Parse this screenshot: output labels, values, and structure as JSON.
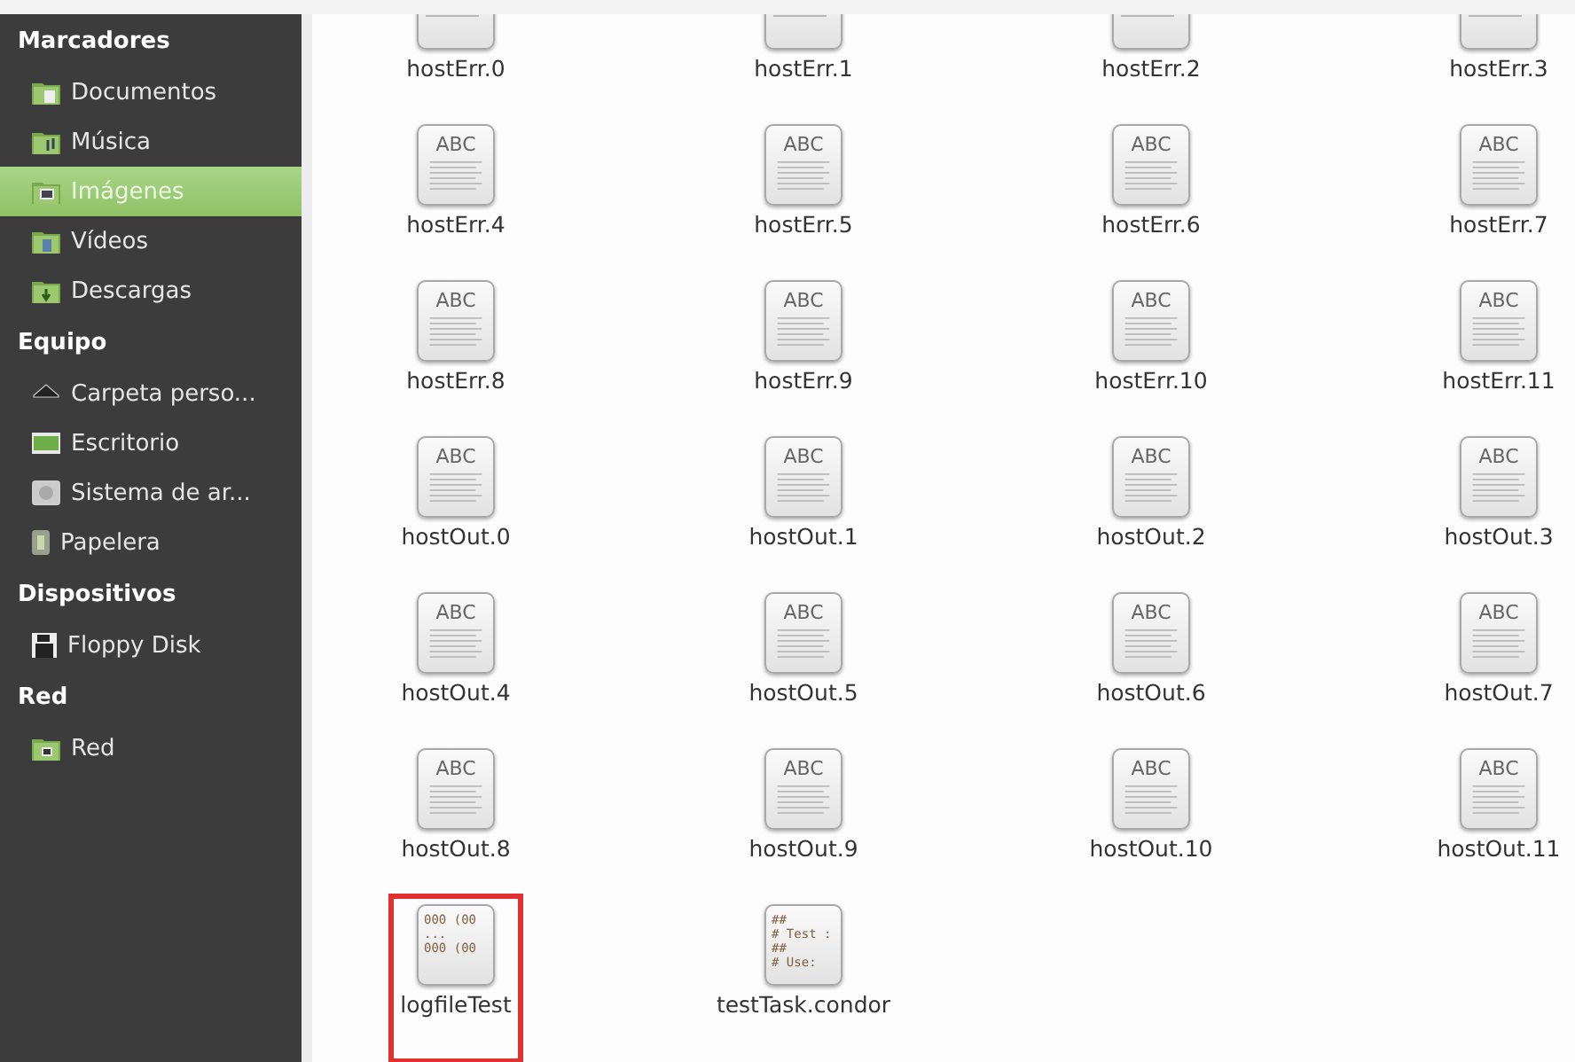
{
  "sidebar": {
    "sections": [
      {
        "title": "Marcadores",
        "items": [
          {
            "label": "Documentos",
            "kind": "folder-doc",
            "selected": false
          },
          {
            "label": "Música",
            "kind": "folder-music",
            "selected": false
          },
          {
            "label": "Imágenes",
            "kind": "folder-picture",
            "selected": true
          },
          {
            "label": "Vídeos",
            "kind": "folder-video",
            "selected": false
          },
          {
            "label": "Descargas",
            "kind": "folder-download",
            "selected": false
          }
        ]
      },
      {
        "title": "Equipo",
        "items": [
          {
            "label": "Carpeta perso...",
            "kind": "home",
            "selected": false
          },
          {
            "label": "Escritorio",
            "kind": "desktop",
            "selected": false
          },
          {
            "label": "Sistema de ar...",
            "kind": "drive",
            "selected": false
          },
          {
            "label": "Papelera",
            "kind": "trash",
            "selected": false
          }
        ]
      },
      {
        "title": "Dispositivos",
        "items": [
          {
            "label": "Floppy Disk",
            "kind": "floppy",
            "selected": false
          }
        ]
      },
      {
        "title": "Red",
        "items": [
          {
            "label": "Red",
            "kind": "folder-network",
            "selected": false
          }
        ]
      }
    ]
  },
  "files": [
    {
      "name": "hostErr.0",
      "kind": "text",
      "highlighted": false
    },
    {
      "name": "hostErr.1",
      "kind": "text",
      "highlighted": false
    },
    {
      "name": "hostErr.2",
      "kind": "text",
      "highlighted": false
    },
    {
      "name": "hostErr.3",
      "kind": "text",
      "highlighted": false
    },
    {
      "name": "hostErr.4",
      "kind": "text",
      "thumb": [
        "ABC"
      ],
      "highlighted": false
    },
    {
      "name": "hostErr.5",
      "kind": "text",
      "thumb": [
        "ABC"
      ],
      "highlighted": false
    },
    {
      "name": "hostErr.6",
      "kind": "text",
      "thumb": [
        "ABC"
      ],
      "highlighted": false
    },
    {
      "name": "hostErr.7",
      "kind": "text",
      "thumb": [
        "ABC"
      ],
      "highlighted": false
    },
    {
      "name": "hostErr.8",
      "kind": "text",
      "thumb": [
        "ABC"
      ],
      "highlighted": false
    },
    {
      "name": "hostErr.9",
      "kind": "text",
      "thumb": [
        "ABC"
      ],
      "highlighted": false
    },
    {
      "name": "hostErr.10",
      "kind": "text",
      "thumb": [
        "ABC"
      ],
      "highlighted": false
    },
    {
      "name": "hostErr.11",
      "kind": "text",
      "thumb": [
        "ABC"
      ],
      "highlighted": false
    },
    {
      "name": "hostOut.0",
      "kind": "text",
      "thumb": [
        "ABC"
      ],
      "highlighted": false
    },
    {
      "name": "hostOut.1",
      "kind": "text",
      "thumb": [
        "ABC"
      ],
      "highlighted": false
    },
    {
      "name": "hostOut.2",
      "kind": "text",
      "thumb": [
        "ABC"
      ],
      "highlighted": false
    },
    {
      "name": "hostOut.3",
      "kind": "text",
      "thumb": [
        "ABC"
      ],
      "highlighted": false
    },
    {
      "name": "hostOut.4",
      "kind": "text",
      "thumb": [
        "ABC"
      ],
      "highlighted": false
    },
    {
      "name": "hostOut.5",
      "kind": "text",
      "thumb": [
        "ABC"
      ],
      "highlighted": false
    },
    {
      "name": "hostOut.6",
      "kind": "text",
      "thumb": [
        "ABC"
      ],
      "highlighted": false
    },
    {
      "name": "hostOut.7",
      "kind": "text",
      "thumb": [
        "ABC"
      ],
      "highlighted": false
    },
    {
      "name": "hostOut.8",
      "kind": "text",
      "thumb": [
        "ABC"
      ],
      "highlighted": false
    },
    {
      "name": "hostOut.9",
      "kind": "text",
      "thumb": [
        "ABC"
      ],
      "highlighted": false
    },
    {
      "name": "hostOut.10",
      "kind": "text",
      "thumb": [
        "ABC"
      ],
      "highlighted": false
    },
    {
      "name": "hostOut.11",
      "kind": "text",
      "thumb": [
        "ABC"
      ],
      "highlighted": false
    },
    {
      "name": "logfileTest",
      "kind": "preview",
      "thumb": [
        "000 (00",
        "...",
        "000 (00"
      ],
      "highlighted": true
    },
    {
      "name": "testTask.condor",
      "kind": "preview",
      "thumb": [
        "##",
        "# Test :",
        "##",
        "# Use:"
      ],
      "highlighted": false
    }
  ]
}
